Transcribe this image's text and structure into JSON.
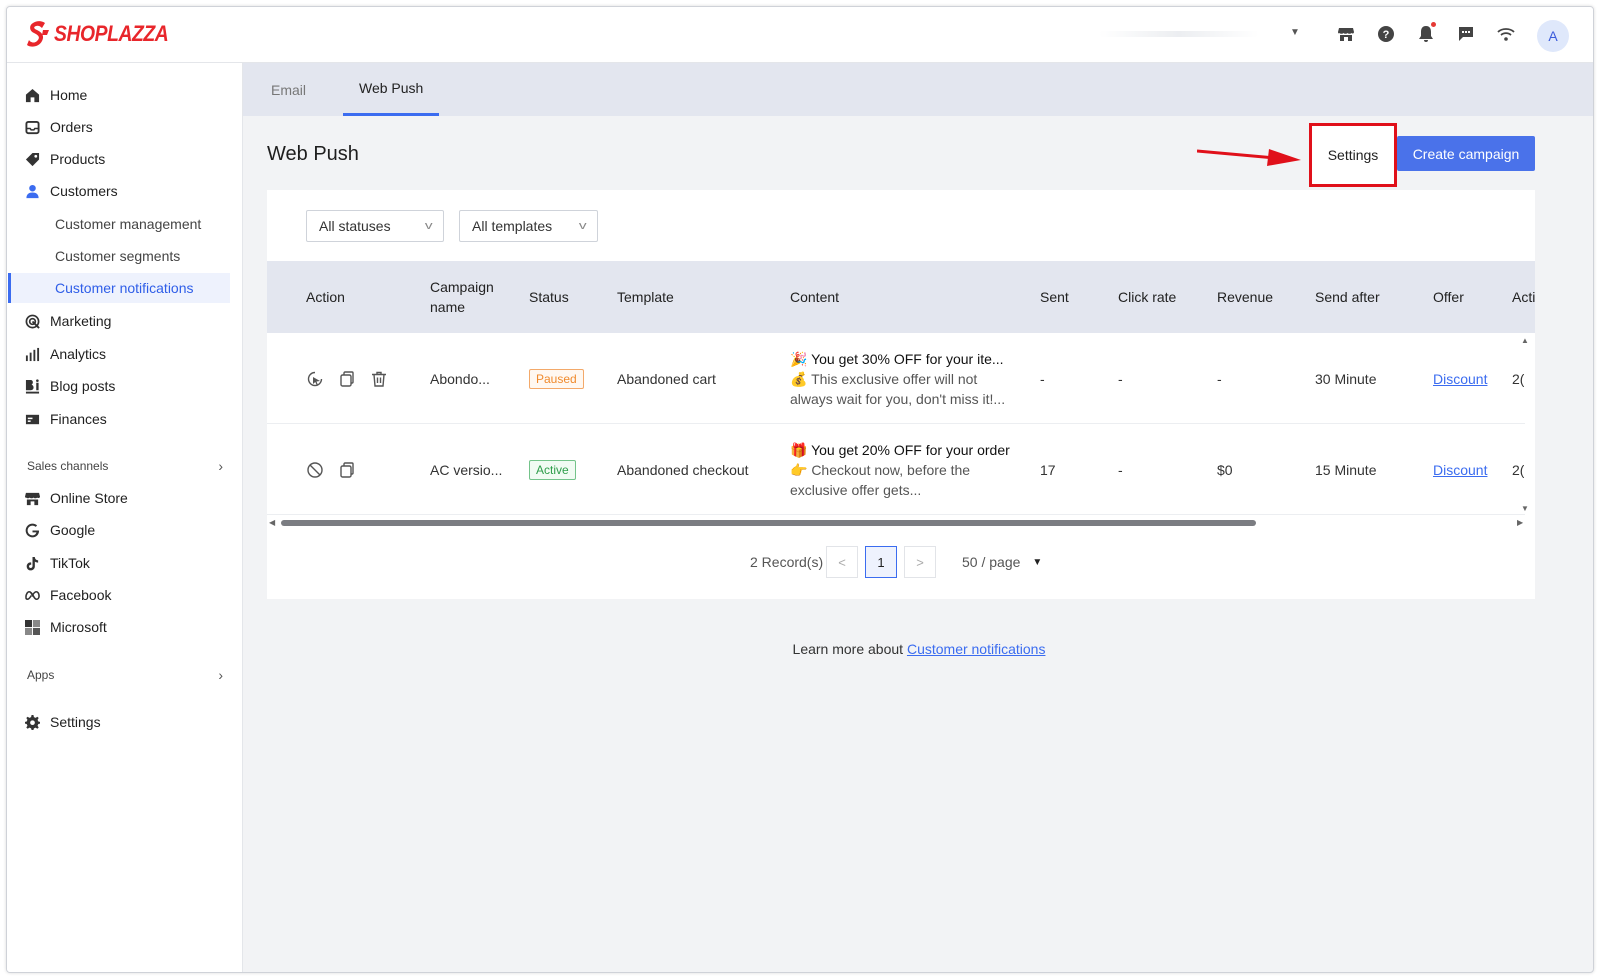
{
  "brand": {
    "name": "SHOPLAZZA",
    "color": "#e8262b"
  },
  "topbar": {
    "avatar_letter": "A",
    "icons": [
      "store-icon",
      "help-icon",
      "bell-icon",
      "message-icon",
      "wifi-icon"
    ]
  },
  "sidebar": {
    "items": [
      {
        "label": "Home",
        "icon": "home-icon"
      },
      {
        "label": "Orders",
        "icon": "orders-icon"
      },
      {
        "label": "Products",
        "icon": "tag-icon"
      },
      {
        "label": "Customers",
        "icon": "person-icon"
      },
      {
        "label": "Marketing",
        "icon": "marketing-icon"
      },
      {
        "label": "Analytics",
        "icon": "bar-chart-icon"
      },
      {
        "label": "Blog posts",
        "icon": "blog-icon"
      },
      {
        "label": "Finances",
        "icon": "finance-icon"
      }
    ],
    "customer_sub": [
      "Customer management",
      "Customer segments",
      "Customer notifications"
    ],
    "sales_channels_title": "Sales channels",
    "sales_channels": [
      {
        "label": "Online Store",
        "icon": "store-icon"
      },
      {
        "label": "Google",
        "icon": "google-icon"
      },
      {
        "label": "TikTok",
        "icon": "tiktok-icon"
      },
      {
        "label": "Facebook",
        "icon": "meta-icon"
      },
      {
        "label": "Microsoft",
        "icon": "microsoft-icon"
      }
    ],
    "apps_title": "Apps",
    "settings_label": "Settings"
  },
  "tabs": [
    {
      "label": "Email"
    },
    {
      "label": "Web Push"
    }
  ],
  "page": {
    "title": "Web Push",
    "settings_label": "Settings",
    "create_label": "Create campaign",
    "accent": "#4a72ea",
    "highlight": "#e0101a"
  },
  "filters": {
    "status": "All statuses",
    "template": "All templates"
  },
  "table": {
    "headers": {
      "action": "Action",
      "campaign_name_1": "Campaign",
      "campaign_name_2": "name",
      "status": "Status",
      "template": "Template",
      "content": "Content",
      "sent": "Sent",
      "click_rate": "Click rate",
      "revenue": "Revenue",
      "send_after": "Send after",
      "offer": "Offer",
      "active": "Acti"
    },
    "rows": [
      {
        "name": "Abondo...",
        "status": "Paused",
        "template": "Abandoned cart",
        "content_title": "🎉 You get 30% OFF for your ite...",
        "content_body_1": "💰 This exclusive offer will not",
        "content_body_2": "always wait for you, don't miss it!...",
        "sent": "-",
        "click_rate": "-",
        "revenue": "-",
        "send_after": "30 Minute",
        "offer": "Discount",
        "active": "2("
      },
      {
        "name": "AC versio...",
        "status": "Active",
        "template": "Abandoned checkout",
        "content_title": "🎁 You get 20% OFF for your order",
        "content_body_1": "👉 Checkout now, before the",
        "content_body_2": "exclusive offer gets...",
        "sent": "17",
        "click_rate": "-",
        "revenue": "$0",
        "send_after": "15 Minute",
        "offer": "Discount",
        "active": "2("
      }
    ]
  },
  "pagination": {
    "records": "2 Record(s)",
    "current": "1",
    "page_size": "50 / page",
    "prev": "<",
    "next": ">"
  },
  "footer": {
    "text": "Learn more about",
    "link": "Customer notifications"
  }
}
